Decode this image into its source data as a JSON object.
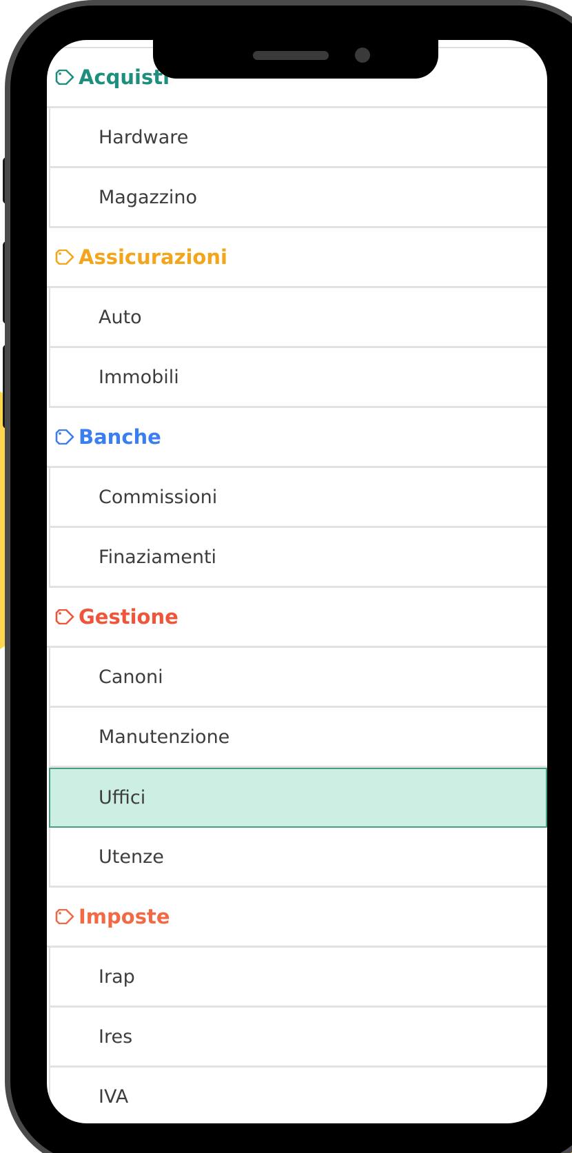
{
  "categories": [
    {
      "title": "Acquisti",
      "color": "#1f8f7d",
      "items": [
        {
          "label": "Hardware"
        },
        {
          "label": "Magazzino"
        }
      ]
    },
    {
      "title": "Assicurazioni",
      "color": "#f3a51c",
      "items": [
        {
          "label": "Auto"
        },
        {
          "label": "Immobili"
        }
      ]
    },
    {
      "title": "Banche",
      "color": "#3a7ef0",
      "items": [
        {
          "label": "Commissioni"
        },
        {
          "label": "Finaziamenti"
        }
      ]
    },
    {
      "title": "Gestione",
      "color": "#f0553a",
      "items": [
        {
          "label": "Canoni"
        },
        {
          "label": "Manutenzione"
        },
        {
          "label": "Uffici",
          "selected": true
        },
        {
          "label": "Utenze"
        }
      ]
    },
    {
      "title": "Imposte",
      "color": "#f26a45",
      "items": [
        {
          "label": "Irap"
        },
        {
          "label": "Ires"
        },
        {
          "label": "IVA"
        }
      ]
    }
  ],
  "icon": "tag-icon"
}
